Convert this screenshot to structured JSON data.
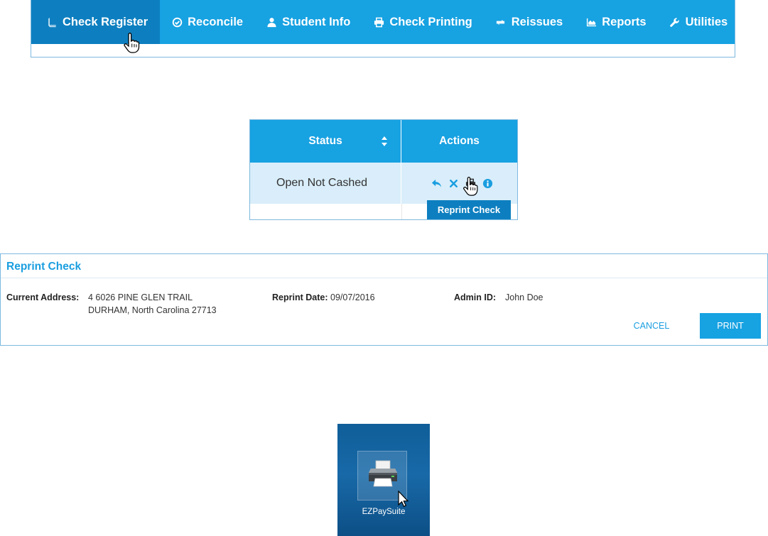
{
  "nav": {
    "items": [
      {
        "label": "Check Register",
        "icon": "book-icon"
      },
      {
        "label": "Reconcile",
        "icon": "check-circle-icon"
      },
      {
        "label": "Student Info",
        "icon": "user-icon"
      },
      {
        "label": "Check Printing",
        "icon": "printer-icon"
      },
      {
        "label": "Reissues",
        "icon": "retweet-icon"
      },
      {
        "label": "Reports",
        "icon": "area-chart-icon"
      },
      {
        "label": "Utilities",
        "icon": "wrench-icon"
      }
    ],
    "active_item": "Check Register"
  },
  "table": {
    "columns": [
      "Status",
      "Actions"
    ],
    "rows": [
      {
        "status": "Open Not Cashed",
        "actions": [
          "reply-icon",
          "close-icon",
          "printer-icon",
          "info-icon"
        ]
      }
    ],
    "tooltip": "Reprint Check"
  },
  "reprint": {
    "title": "Reprint Check",
    "current_address_label": "Current Address:",
    "address_line1": "4 6026 PINE GLEN TRAIL",
    "address_line2": "DURHAM, North Carolina 27713",
    "reprint_date_label": "Reprint Date:",
    "reprint_date": "09/07/2016",
    "admin_id_label": "Admin ID:",
    "admin_id": "John Doe",
    "cancel_label": "CANCEL",
    "print_label": "PRINT"
  },
  "desktop": {
    "icon_label": "EZPaySuite"
  },
  "colors": {
    "primary_blue": "#17a2e2",
    "active_blue": "#0d7fc0",
    "row_highlight": "#d9eefa",
    "desktop_bg": "#0f5e99"
  }
}
